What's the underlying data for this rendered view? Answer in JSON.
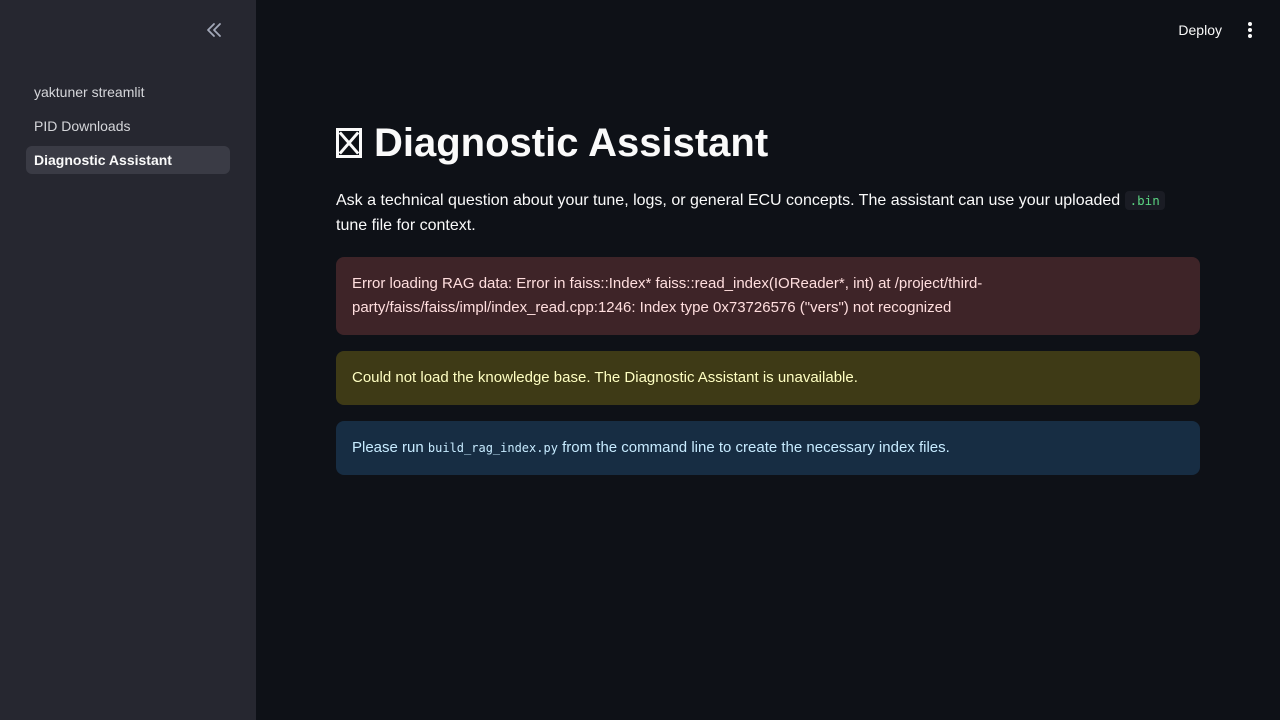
{
  "sidebar": {
    "collapse_icon": "double-chevron-left-icon",
    "items": [
      {
        "label": "yaktuner streamlit",
        "active": false
      },
      {
        "label": "PID Downloads",
        "active": false
      },
      {
        "label": "Diagnostic Assistant",
        "active": true
      }
    ]
  },
  "header": {
    "deploy_label": "Deploy",
    "menu_icon": "vertical-ellipsis-icon"
  },
  "main": {
    "title_glyph": "missing-glyph-box",
    "title": "Diagnostic Assistant",
    "intro_before": "Ask a technical question about your tune, logs, or general ECU concepts. The assistant can use your uploaded ",
    "intro_code": ".bin",
    "intro_after": " tune file for context.",
    "error_text": "Error loading RAG data: Error in faiss::Index* faiss::read_index(IOReader*, int) at /project/third-party/faiss/faiss/impl/index_read.cpp:1246: Index type 0x73726576 (\"vers\") not recognized",
    "warning_text": "Could not load the knowledge base. The Diagnostic Assistant is unavailable.",
    "info_before": "Please run ",
    "info_code": "build_rag_index.py",
    "info_after": " from the command line to create the necessary index files."
  },
  "colors": {
    "background": "#0e1117",
    "sidebar": "#262730",
    "error_bg": "#3e2428",
    "warning_bg": "#3e3a16",
    "info_bg": "#172d43",
    "code_green": "#5ad281"
  }
}
